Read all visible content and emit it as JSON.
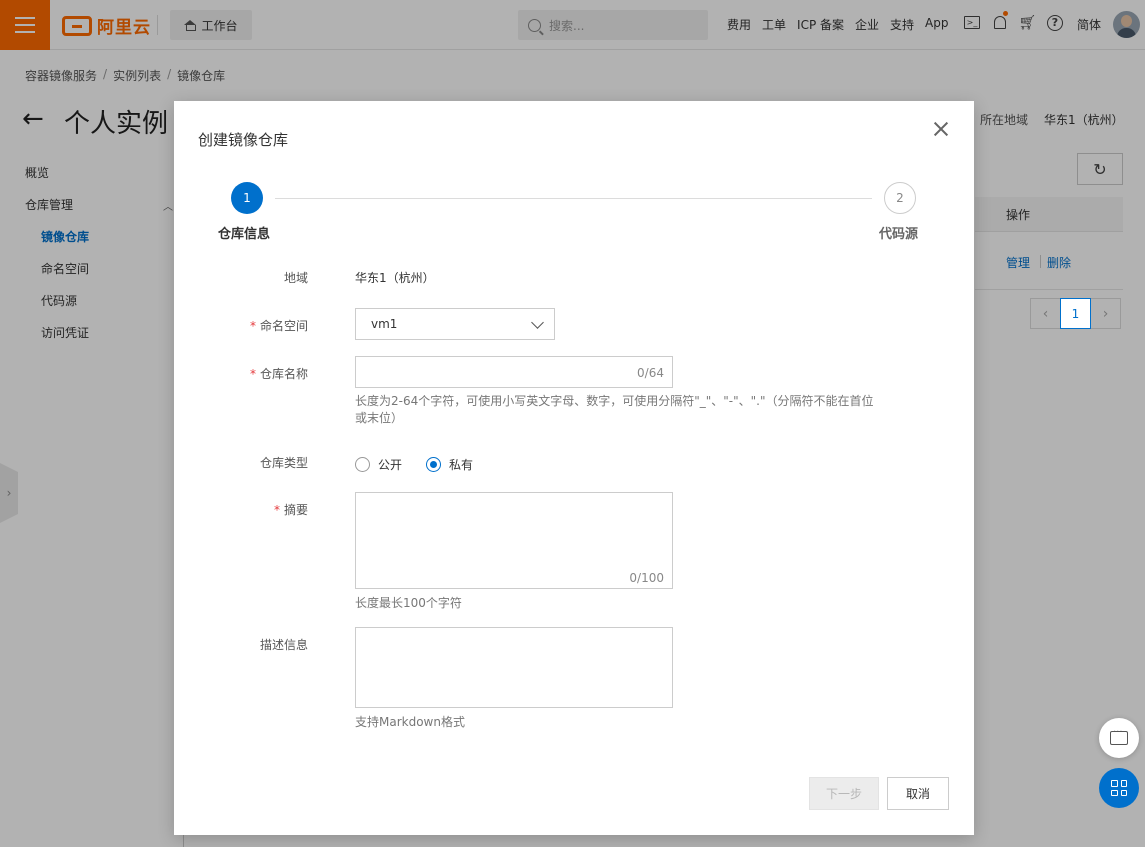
{
  "topbar": {
    "logo_text": "阿里云",
    "workbench": "工作台",
    "search_placeholder": "搜索...",
    "nav": [
      "费用",
      "工单",
      "ICP 备案",
      "企业",
      "支持",
      "App"
    ],
    "lang": "简体",
    "accent_color": "#ff6a00"
  },
  "breadcrumb": [
    "容器镜像服务",
    "实例列表",
    "镜像仓库"
  ],
  "page": {
    "back_arrow": "←",
    "title": "个人实例",
    "region_label": "所在地域",
    "region_value": "华东1（杭州）"
  },
  "sidebar": {
    "items": [
      {
        "label": "概览"
      },
      {
        "label": "仓库管理"
      },
      {
        "label": "镜像仓库"
      },
      {
        "label": "命名空间"
      },
      {
        "label": "代码源"
      },
      {
        "label": "访问凭证"
      }
    ]
  },
  "table": {
    "ops_header": "操作",
    "manage": "管理",
    "delete": "删除",
    "page": "1"
  },
  "modal": {
    "title": "创建镜像仓库",
    "steps": [
      {
        "number": "1",
        "label": "仓库信息"
      },
      {
        "number": "2",
        "label": "代码源"
      }
    ],
    "fields": {
      "region": {
        "label": "地域",
        "value": "华东1（杭州）"
      },
      "namespace": {
        "label": "命名空间",
        "value": "vm1"
      },
      "repo_name": {
        "label": "仓库名称",
        "counter": "0/64",
        "help": "长度为2-64个字符，可使用小写英文字母、数字，可使用分隔符\"_\"、\"-\"、\".\"（分隔符不能在首位或末位）"
      },
      "repo_type": {
        "label": "仓库类型",
        "options": [
          "公开",
          "私有"
        ],
        "selected": "私有"
      },
      "summary": {
        "label": "摘要",
        "counter": "0/100",
        "help": "长度最长100个字符"
      },
      "description": {
        "label": "描述信息",
        "help": "支持Markdown格式"
      }
    },
    "required_mark": "*",
    "buttons": {
      "next": "下一步",
      "cancel": "取消"
    },
    "primary_color": "#0070cc"
  }
}
